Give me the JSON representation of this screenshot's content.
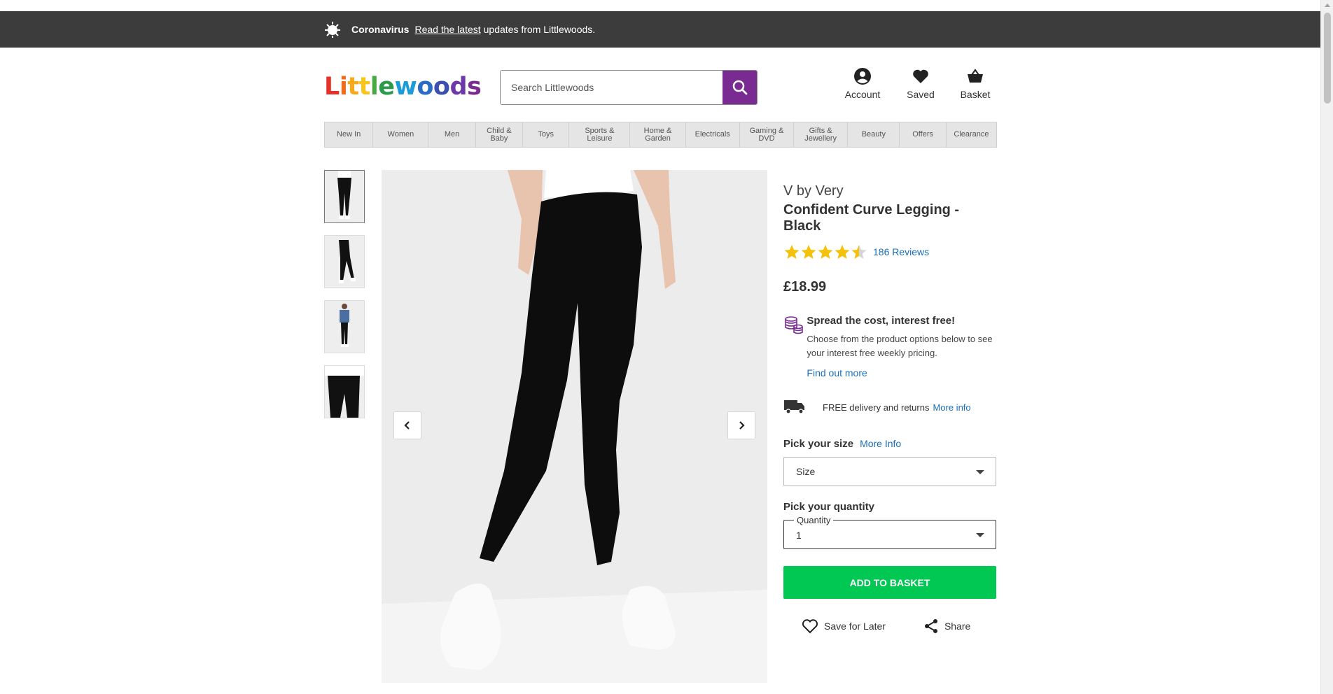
{
  "banner": {
    "title": "Coronavirus",
    "link": "Read the latest",
    "text": "updates from Littlewoods."
  },
  "logo": {
    "letters": [
      "L",
      "i",
      "t",
      "t",
      "l",
      "e",
      "w",
      "o",
      "o",
      "d",
      "s"
    ],
    "colors": [
      "#e4322b",
      "#f26b1d",
      "#f7a81b",
      "#f7c51b",
      "#49a942",
      "#2b9a4a",
      "#1b9bd7",
      "#2b6cc4",
      "#3a4fb0",
      "#6b3aa8",
      "#7a2b91"
    ]
  },
  "search": {
    "placeholder": "Search Littlewoods"
  },
  "header": {
    "account": "Account",
    "saved": "Saved",
    "basket": "Basket"
  },
  "nav": [
    {
      "label": "New In",
      "w": 70
    },
    {
      "label": "Women",
      "w": 80
    },
    {
      "label": "Men",
      "w": 68
    },
    {
      "label": "Child &\nBaby",
      "w": 68
    },
    {
      "label": "Toys",
      "w": 67
    },
    {
      "label": "Sports &\nLeisure",
      "w": 88
    },
    {
      "label": "Home &\nGarden",
      "w": 80
    },
    {
      "label": "Electricals",
      "w": 78
    },
    {
      "label": "Gaming &\nDVD",
      "w": 78
    },
    {
      "label": "Gifts &\nJewellery",
      "w": 78
    },
    {
      "label": "Beauty",
      "w": 75
    },
    {
      "label": "Offers",
      "w": 67
    },
    {
      "label": "Clearance",
      "w": 72
    }
  ],
  "product": {
    "brand": "V by Very",
    "name": "Confident Curve Legging - Black",
    "rating": 4.5,
    "reviews": "186 Reviews",
    "price": "£18.99"
  },
  "finance": {
    "title": "Spread the cost, interest free!",
    "text": "Choose from the product options below to see your interest free weekly pricing.",
    "link": "Find out more"
  },
  "delivery": {
    "text": "FREE delivery and returns",
    "link": "More info"
  },
  "size": {
    "label": "Pick your size",
    "more": "More Info",
    "value": "Size"
  },
  "quantity": {
    "label": "Pick your quantity",
    "legend": "Quantity",
    "value": "1"
  },
  "add_to_basket": "ADD TO BASKET",
  "actions": {
    "save": "Save for Later",
    "share": "Share"
  },
  "colors": {
    "brand_purple": "#7a2b91",
    "add_green": "#00c853",
    "link_blue": "#1a6fb8",
    "banner_bg": "#3c3c3c",
    "star": "#f4c20d"
  }
}
